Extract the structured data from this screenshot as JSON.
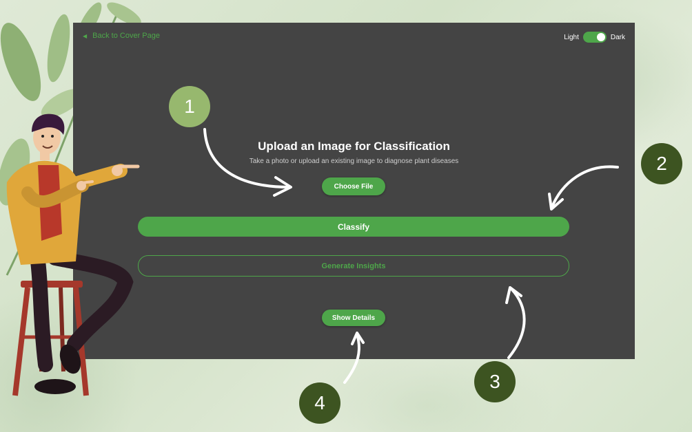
{
  "app": {
    "back_link": "Back to Cover Page",
    "theme": {
      "light_label": "Light",
      "dark_label": "Dark",
      "mode": "dark"
    },
    "title": "Upload an Image for Classification",
    "subtitle": "Take a photo or upload an existing image to diagnose plant diseases",
    "choose_file_label": "Choose File",
    "classify_label": "Classify",
    "insights_label": "Generate Insights",
    "show_details_label": "Show Details"
  },
  "markers": [
    "1",
    "2",
    "3",
    "4"
  ],
  "colors": {
    "accent": "#4ea64a",
    "panel": "#444444",
    "marker_light": "#97b86e",
    "marker_dark": "#3d5421"
  }
}
